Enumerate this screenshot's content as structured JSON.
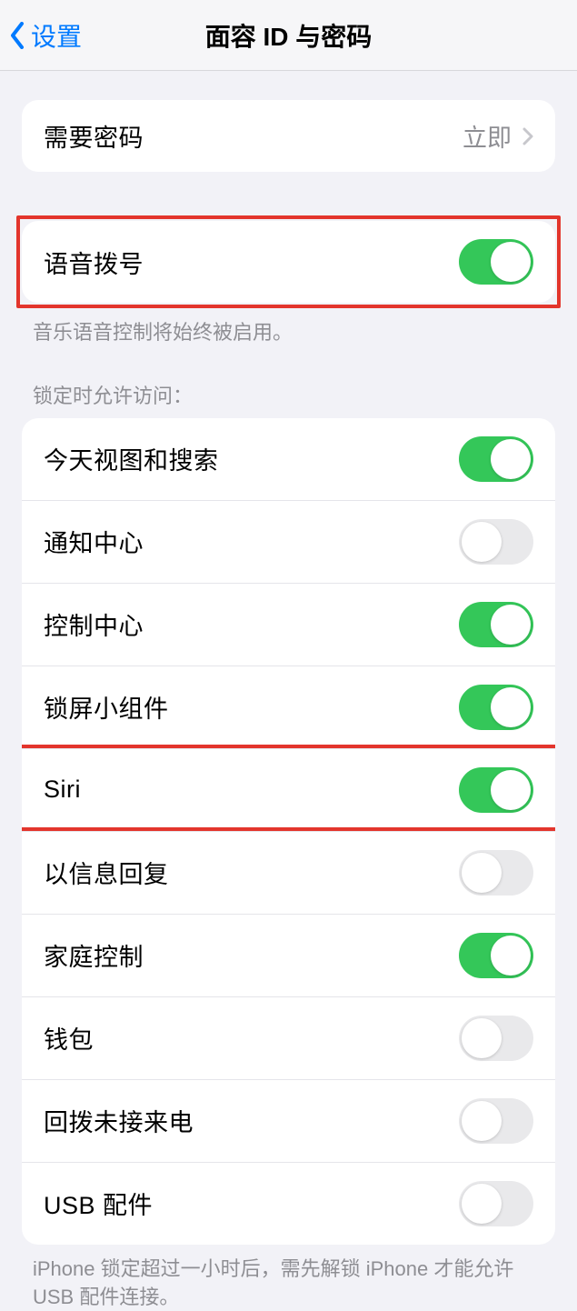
{
  "nav": {
    "back_label": "设置",
    "title": "面容 ID 与密码"
  },
  "require_passcode": {
    "label": "需要密码",
    "value": "立即"
  },
  "voice_dial": {
    "label": "语音拨号",
    "on": true,
    "footer": "音乐语音控制将始终被启用。"
  },
  "lock_access": {
    "header": "锁定时允许访问：",
    "items": [
      {
        "label": "今天视图和搜索",
        "on": true
      },
      {
        "label": "通知中心",
        "on": false
      },
      {
        "label": "控制中心",
        "on": true
      },
      {
        "label": "锁屏小组件",
        "on": true
      },
      {
        "label": "Siri",
        "on": true
      },
      {
        "label": "以信息回复",
        "on": false
      },
      {
        "label": "家庭控制",
        "on": true
      },
      {
        "label": "钱包",
        "on": false
      },
      {
        "label": "回拨未接来电",
        "on": false
      },
      {
        "label": "USB 配件",
        "on": false
      }
    ],
    "footer": "iPhone 锁定超过一小时后，需先解锁 iPhone 才能允许USB 配件连接。"
  }
}
